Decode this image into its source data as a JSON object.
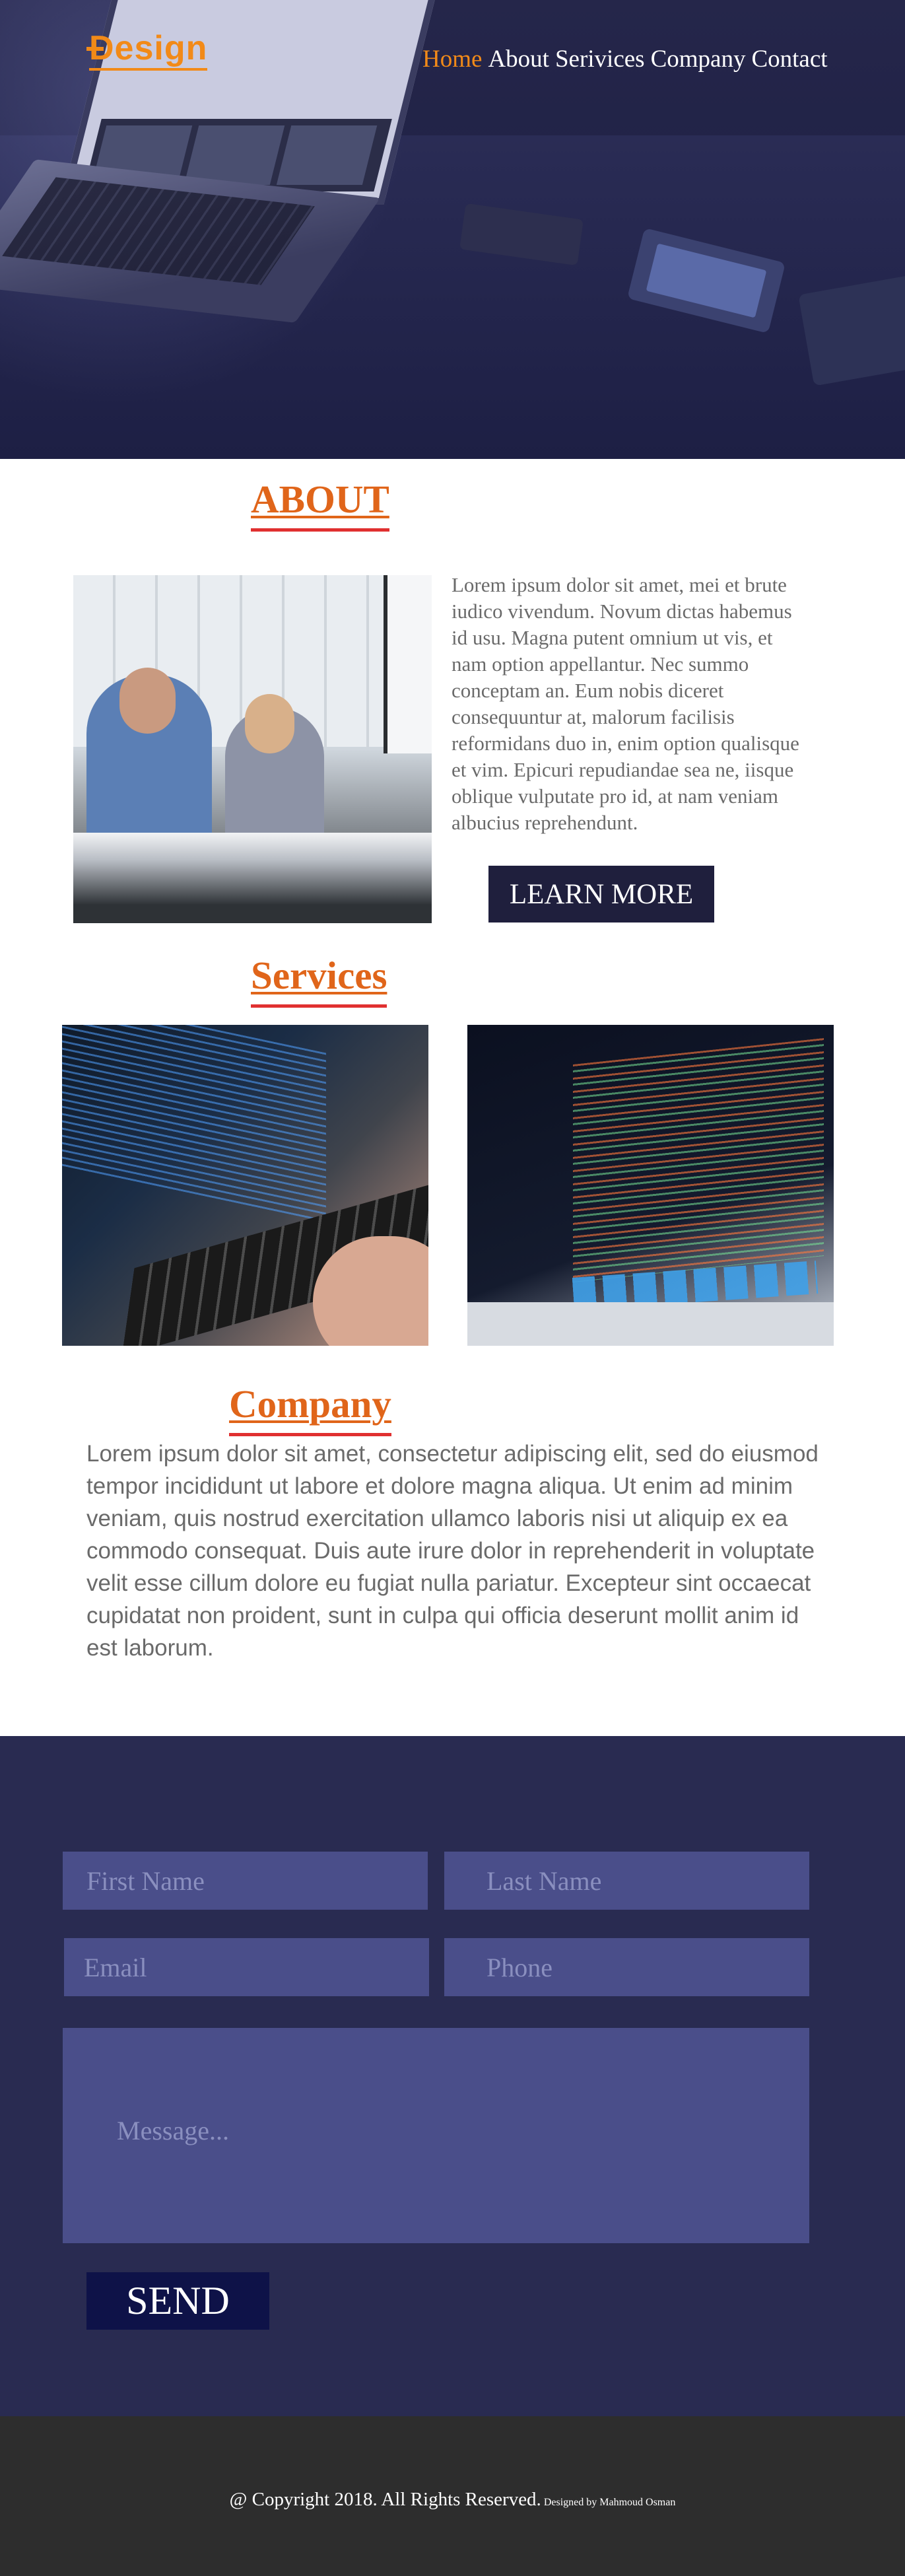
{
  "brand": {
    "logo": "Design",
    "accent": "#f28a18"
  },
  "nav": {
    "items": [
      "Home",
      "About",
      "Services",
      "Company",
      "Contact"
    ],
    "items_display": [
      "Home",
      "About",
      "Serivices",
      "Company",
      "Contact"
    ],
    "active": "Home"
  },
  "about": {
    "title": "ABOUT",
    "text": "Lorem ipsum dolor sit amet, mei et brute iudico vivendum. Novum dictas habemus id usu. Magna putent omnium ut vis, et nam option appellantur. Nec summo conceptam an. Eum nobis diceret consequuntur at, malorum facilisis reformidans duo in, enim option qualisque et vim. Epicuri repudiandae sea ne, iisque oblique vulputate pro id, at nam veniam albucius reprehendunt.",
    "button": "LEARN MORE"
  },
  "services": {
    "title": "Services"
  },
  "company": {
    "title": "Company",
    "text": "Lorem ipsum dolor sit amet, consectetur adipiscing elit, sed do eiusmod tempor incididunt ut labore et dolore magna aliqua. Ut enim ad minim veniam, quis nostrud exercitation ullamco laboris nisi ut aliquip ex ea commodo consequat. Duis aute irure dolor in reprehenderit in voluptate velit esse cillum dolore eu fugiat nulla pariatur. Excepteur sint occaecat cupidatat non proident, sunt in culpa qui officia deserunt mollit anim id est laborum."
  },
  "contact": {
    "first_name_placeholder": "First Name",
    "last_name_placeholder": "Last Name",
    "email_placeholder": "Email",
    "phone_placeholder": "Phone",
    "message_placeholder": "Message...",
    "send": "SEND",
    "background": "#292b51",
    "field_color": "#4a4e8a"
  },
  "footer": {
    "copyright": "@ Copyright 2018. All Rights Reserved.",
    "credit": "Designed by Mahmoud Osman"
  },
  "colors": {
    "heading": "#e0651a",
    "underline": "#e03030",
    "button_dark": "#1f1f3d",
    "footer": "#2d2d2d"
  }
}
